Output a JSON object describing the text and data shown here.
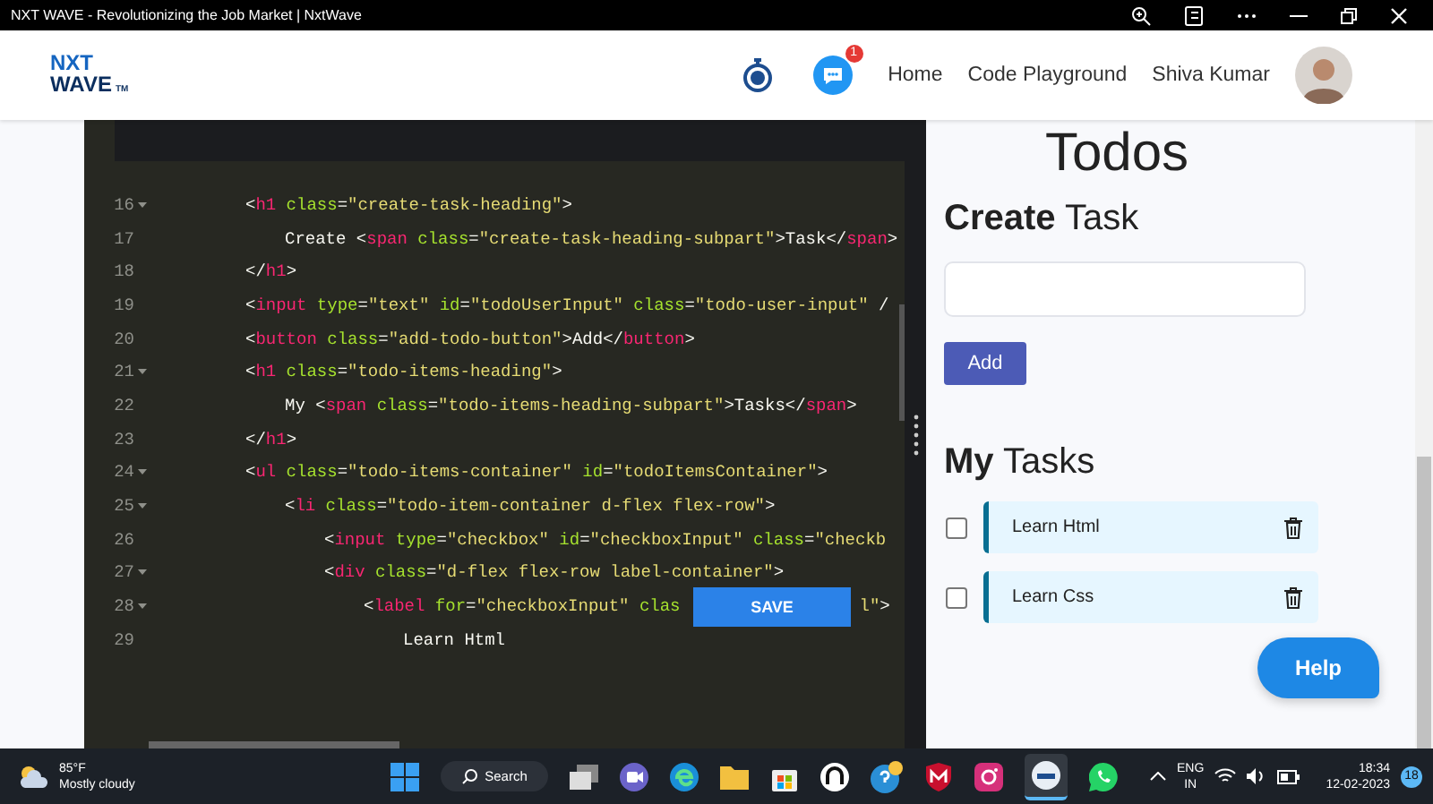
{
  "window": {
    "title": "NXT WAVE - Revolutionizing the Job Market | NxtWave"
  },
  "header": {
    "logo": {
      "line1": "NXT",
      "line2": "WAVE",
      "mark": "TM"
    },
    "notification_count": "1",
    "nav": [
      {
        "label": "Home"
      },
      {
        "label": "Code Playground"
      }
    ],
    "user": "Shiva Kumar"
  },
  "editor": {
    "save_button": "SAVE",
    "lines": [
      {
        "number": "16",
        "foldable": true,
        "tokens": [
          {
            "kind": "punct",
            "text": "<"
          },
          {
            "kind": "tag",
            "text": "h1"
          },
          {
            "kind": "attr",
            "text": " class"
          },
          {
            "kind": "punct",
            "text": "="
          },
          {
            "kind": "str",
            "text": "\"create-task-heading\""
          },
          {
            "kind": "punct",
            "text": ">"
          }
        ],
        "children": [
          {
            "number": "17",
            "foldable": false,
            "tokens": [
              {
                "kind": "text",
                "text": "Create "
              },
              {
                "kind": "punct",
                "text": "<"
              },
              {
                "kind": "tag",
                "text": "span"
              },
              {
                "kind": "attr",
                "text": " class"
              },
              {
                "kind": "punct",
                "text": "="
              },
              {
                "kind": "str",
                "text": "\"create-task-heading-subpart\""
              },
              {
                "kind": "punct",
                "text": ">"
              },
              {
                "kind": "text",
                "text": "Task"
              },
              {
                "kind": "punct",
                "text": "</"
              },
              {
                "kind": "tag",
                "text": "span"
              },
              {
                "kind": "punct",
                "text": ">"
              }
            ]
          }
        ]
      },
      {
        "number": "18",
        "foldable": false,
        "tokens": [
          {
            "kind": "punct",
            "text": "</"
          },
          {
            "kind": "tag",
            "text": "h1"
          },
          {
            "kind": "punct",
            "text": ">"
          }
        ]
      },
      {
        "number": "19",
        "foldable": false,
        "tokens": [
          {
            "kind": "punct",
            "text": "<"
          },
          {
            "kind": "tag",
            "text": "input"
          },
          {
            "kind": "attr",
            "text": " type"
          },
          {
            "kind": "punct",
            "text": "="
          },
          {
            "kind": "str",
            "text": "\"text\""
          },
          {
            "kind": "attr",
            "text": " id"
          },
          {
            "kind": "punct",
            "text": "="
          },
          {
            "kind": "str",
            "text": "\"todoUserInput\""
          },
          {
            "kind": "attr",
            "text": " class"
          },
          {
            "kind": "punct",
            "text": "="
          },
          {
            "kind": "str",
            "text": "\"todo-user-input\""
          },
          {
            "kind": "punct",
            "text": " /"
          }
        ]
      },
      {
        "number": "20",
        "foldable": false,
        "tokens": [
          {
            "kind": "punct",
            "text": "<"
          },
          {
            "kind": "tag",
            "text": "button"
          },
          {
            "kind": "attr",
            "text": " class"
          },
          {
            "kind": "punct",
            "text": "="
          },
          {
            "kind": "str",
            "text": "\"add-todo-button\""
          },
          {
            "kind": "punct",
            "text": ">"
          },
          {
            "kind": "text",
            "text": "Add"
          },
          {
            "kind": "punct",
            "text": "</"
          },
          {
            "kind": "tag",
            "text": "button"
          },
          {
            "kind": "punct",
            "text": ">"
          }
        ]
      },
      {
        "number": "21",
        "foldable": true,
        "tokens": [
          {
            "kind": "punct",
            "text": "<"
          },
          {
            "kind": "tag",
            "text": "h1"
          },
          {
            "kind": "attr",
            "text": " class"
          },
          {
            "kind": "punct",
            "text": "="
          },
          {
            "kind": "str",
            "text": "\"todo-items-heading\""
          },
          {
            "kind": "punct",
            "text": ">"
          }
        ],
        "children": [
          {
            "number": "22",
            "foldable": false,
            "tokens": [
              {
                "kind": "text",
                "text": "My "
              },
              {
                "kind": "punct",
                "text": "<"
              },
              {
                "kind": "tag",
                "text": "span"
              },
              {
                "kind": "attr",
                "text": " class"
              },
              {
                "kind": "punct",
                "text": "="
              },
              {
                "kind": "str",
                "text": "\"todo-items-heading-subpart\""
              },
              {
                "kind": "punct",
                "text": ">"
              },
              {
                "kind": "text",
                "text": "Tasks"
              },
              {
                "kind": "punct",
                "text": "</"
              },
              {
                "kind": "tag",
                "text": "span"
              },
              {
                "kind": "punct",
                "text": ">"
              }
            ]
          }
        ]
      },
      {
        "number": "23",
        "foldable": false,
        "tokens": [
          {
            "kind": "punct",
            "text": "</"
          },
          {
            "kind": "tag",
            "text": "h1"
          },
          {
            "kind": "punct",
            "text": ">"
          }
        ]
      },
      {
        "number": "24",
        "foldable": true,
        "tokens": [
          {
            "kind": "punct",
            "text": "<"
          },
          {
            "kind": "tag",
            "text": "ul"
          },
          {
            "kind": "attr",
            "text": " class"
          },
          {
            "kind": "punct",
            "text": "="
          },
          {
            "kind": "str",
            "text": "\"todo-items-container\""
          },
          {
            "kind": "attr",
            "text": " id"
          },
          {
            "kind": "punct",
            "text": "="
          },
          {
            "kind": "str",
            "text": "\"todoItemsContainer\""
          },
          {
            "kind": "punct",
            "text": ">"
          }
        ],
        "children": [
          {
            "number": "25",
            "foldable": true,
            "tokens": [
              {
                "kind": "punct",
                "text": "<"
              },
              {
                "kind": "tag",
                "text": "li"
              },
              {
                "kind": "attr",
                "text": " class"
              },
              {
                "kind": "punct",
                "text": "="
              },
              {
                "kind": "str",
                "text": "\"todo-item-container d-flex flex-row\""
              },
              {
                "kind": "punct",
                "text": ">"
              }
            ],
            "children": [
              {
                "number": "26",
                "foldable": false,
                "tokens": [
                  {
                    "kind": "punct",
                    "text": "<"
                  },
                  {
                    "kind": "tag",
                    "text": "input"
                  },
                  {
                    "kind": "attr",
                    "text": " type"
                  },
                  {
                    "kind": "punct",
                    "text": "="
                  },
                  {
                    "kind": "str",
                    "text": "\"checkbox\""
                  },
                  {
                    "kind": "attr",
                    "text": " id"
                  },
                  {
                    "kind": "punct",
                    "text": "="
                  },
                  {
                    "kind": "str",
                    "text": "\"checkboxInput\""
                  },
                  {
                    "kind": "attr",
                    "text": " class"
                  },
                  {
                    "kind": "punct",
                    "text": "="
                  },
                  {
                    "kind": "str",
                    "text": "\"checkb"
                  }
                ]
              },
              {
                "number": "27",
                "foldable": true,
                "tokens": [
                  {
                    "kind": "punct",
                    "text": "<"
                  },
                  {
                    "kind": "tag",
                    "text": "div"
                  },
                  {
                    "kind": "attr",
                    "text": " class"
                  },
                  {
                    "kind": "punct",
                    "text": "="
                  },
                  {
                    "kind": "str",
                    "text": "\"d-flex flex-row label-container\""
                  },
                  {
                    "kind": "punct",
                    "text": ">"
                  }
                ],
                "children": [
                  {
                    "number": "28",
                    "foldable": true,
                    "tokens": [
                      {
                        "kind": "punct",
                        "text": "<"
                      },
                      {
                        "kind": "tag",
                        "text": "label"
                      },
                      {
                        "kind": "attr",
                        "text": " for"
                      },
                      {
                        "kind": "punct",
                        "text": "="
                      },
                      {
                        "kind": "str",
                        "text": "\"checkboxInput\""
                      },
                      {
                        "kind": "attr",
                        "text": " clas"
                      }
                    ],
                    "after_save": [
                      {
                        "kind": "str",
                        "text": "l\""
                      },
                      {
                        "kind": "punct",
                        "text": ">"
                      }
                    ],
                    "children": [
                      {
                        "number": "29",
                        "foldable": false,
                        "tokens": [
                          {
                            "kind": "text",
                            "text": "Learn Html"
                          }
                        ]
                      }
                    ]
                  }
                ]
              }
            ]
          }
        ]
      }
    ]
  },
  "todos": {
    "title": "Todos",
    "create_heading": "**Create** Task",
    "add_button": "Add",
    "tasks_heading": "**My** Tasks",
    "tasks": [
      {
        "label": "Learn Html",
        "checked": false
      },
      {
        "label": "Learn Css",
        "checked": false
      }
    ]
  },
  "help_button": "Help",
  "taskbar": {
    "temperature": "85°F",
    "weather": "Mostly cloudy",
    "search": "Search",
    "language": "ENG",
    "region": "IN",
    "time": "18:34",
    "date": "12-02-2023",
    "notifications": "18"
  }
}
